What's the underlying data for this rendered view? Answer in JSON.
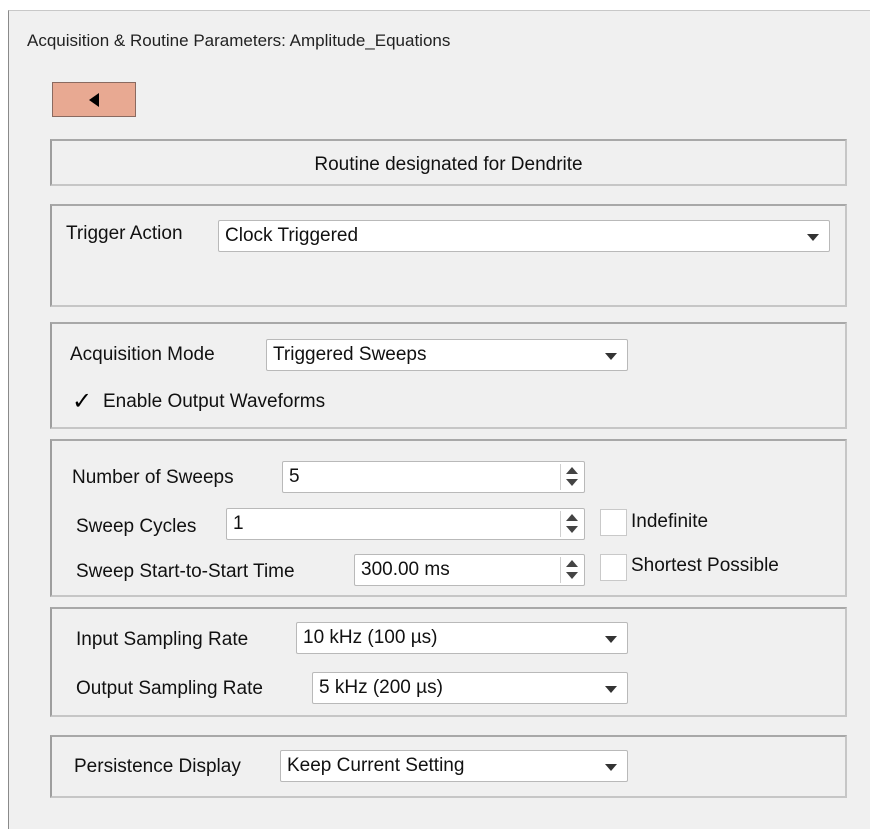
{
  "window": {
    "title": "Acquisition & Routine Parameters: Amplitude_Equations"
  },
  "back_button": {
    "icon": "left-triangle-icon"
  },
  "routine_header": "Routine designated for Dendrite",
  "trigger": {
    "label": "Trigger Action",
    "value": "Clock Triggered"
  },
  "acquisition": {
    "mode_label": "Acquisition Mode",
    "mode_value": "Triggered Sweeps",
    "enable_output_label": "Enable Output Waveforms",
    "enable_output_checked": true,
    "checkmark": "✓"
  },
  "sweeps": {
    "number_label": "Number of Sweeps",
    "number_value": "5",
    "cycles_label": "Sweep Cycles",
    "cycles_value": "1",
    "indefinite_label": "Indefinite",
    "start_to_start_label": "Sweep Start-to-Start Time",
    "start_to_start_value": "300.00 ms",
    "shortest_label": "Shortest Possible"
  },
  "sampling": {
    "input_label": "Input Sampling Rate",
    "input_value": "10 kHz (100 µs)",
    "output_label": "Output Sampling Rate",
    "output_value": "5 kHz (200 µs)"
  },
  "persistence": {
    "label": "Persistence Display",
    "value": "Keep Current Setting"
  }
}
